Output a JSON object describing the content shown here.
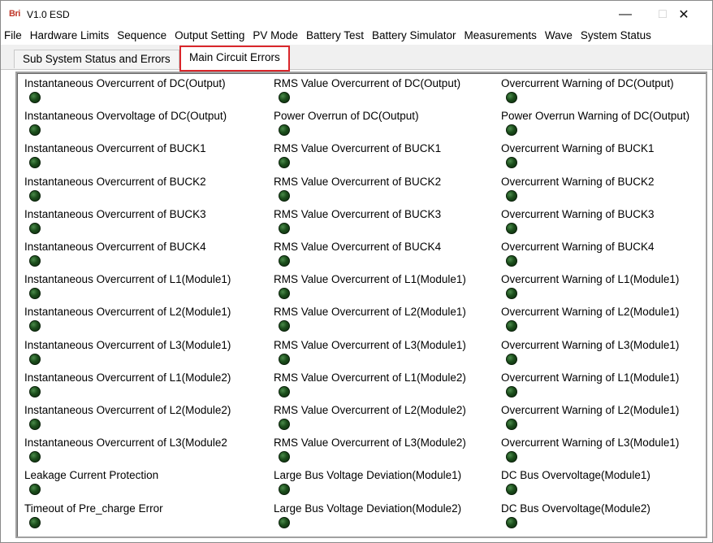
{
  "window": {
    "logo": "Bri",
    "title": "V1.0  ESD",
    "controls": {
      "minimize": "—",
      "maximize": "□",
      "close": "✕"
    }
  },
  "menu": [
    "File",
    "Hardware Limits",
    "Sequence",
    "Output Setting",
    "PV Mode",
    "Battery Test",
    "Battery Simulator",
    "Measurements",
    "Wave",
    "System Status"
  ],
  "tabs": [
    {
      "label": "Sub System Status and Errors",
      "selected": false
    },
    {
      "label": "Main Circuit Errors",
      "selected": true,
      "highlighted": true
    }
  ],
  "indicator_color": "#1f4f1f",
  "errors": [
    [
      "Instantaneous Overcurrent  of DC(Output)",
      "RMS Value Overcurrent of DC(Output)",
      "Overcurrent Warning of DC(Output)"
    ],
    [
      "Instantaneous Overvoltage  of DC(Output)",
      "Power Overrun of DC(Output)",
      "Power Overrun Warning of DC(Output)"
    ],
    [
      "Instantaneous Overcurrent  of BUCK1",
      "RMS Value Overcurrent of BUCK1",
      "Overcurrent Warning of BUCK1"
    ],
    [
      "Instantaneous Overcurrent  of BUCK2",
      "RMS Value Overcurrent of BUCK2",
      "Overcurrent Warning of BUCK2"
    ],
    [
      "Instantaneous Overcurrent  of BUCK3",
      "RMS Value Overcurrent of BUCK3",
      "Overcurrent Warning of BUCK3"
    ],
    [
      "Instantaneous Overcurrent  of BUCK4",
      "RMS Value Overcurrent of BUCK4",
      "Overcurrent Warning of BUCK4"
    ],
    [
      "Instantaneous Overcurrent  of L1(Module1)",
      "RMS Value Overcurrent of L1(Module1)",
      "Overcurrent Warning of L1(Module1)"
    ],
    [
      "Instantaneous Overcurrent  of L2(Module1)",
      "RMS Value Overcurrent of L2(Module1)",
      "Overcurrent Warning of L2(Module1)"
    ],
    [
      "Instantaneous Overcurrent  of L3(Module1)",
      "RMS Value Overcurrent of L3(Module1)",
      "Overcurrent Warning of L3(Module1)"
    ],
    [
      "Instantaneous Overcurrent  of L1(Module2)",
      "RMS Value Overcurrent of L1(Module2)",
      "Overcurrent Warning of L1(Module1)"
    ],
    [
      "Instantaneous Overcurrent  of L2(Module2)",
      "RMS Value Overcurrent of L2(Module2)",
      "Overcurrent Warning of L2(Module1)"
    ],
    [
      "Instantaneous Overcurrent  of L3(Module2",
      "RMS Value Overcurrent of L3(Module2)",
      "Overcurrent Warning of L3(Module1)"
    ],
    [
      "Leakage Current Protection",
      "Large Bus Voltage Deviation(Module1)",
      "DC Bus Overvoltage(Module1)"
    ],
    [
      "Timeout of Pre_charge Error",
      "Large Bus Voltage Deviation(Module2)",
      "DC Bus Overvoltage(Module2)"
    ]
  ]
}
